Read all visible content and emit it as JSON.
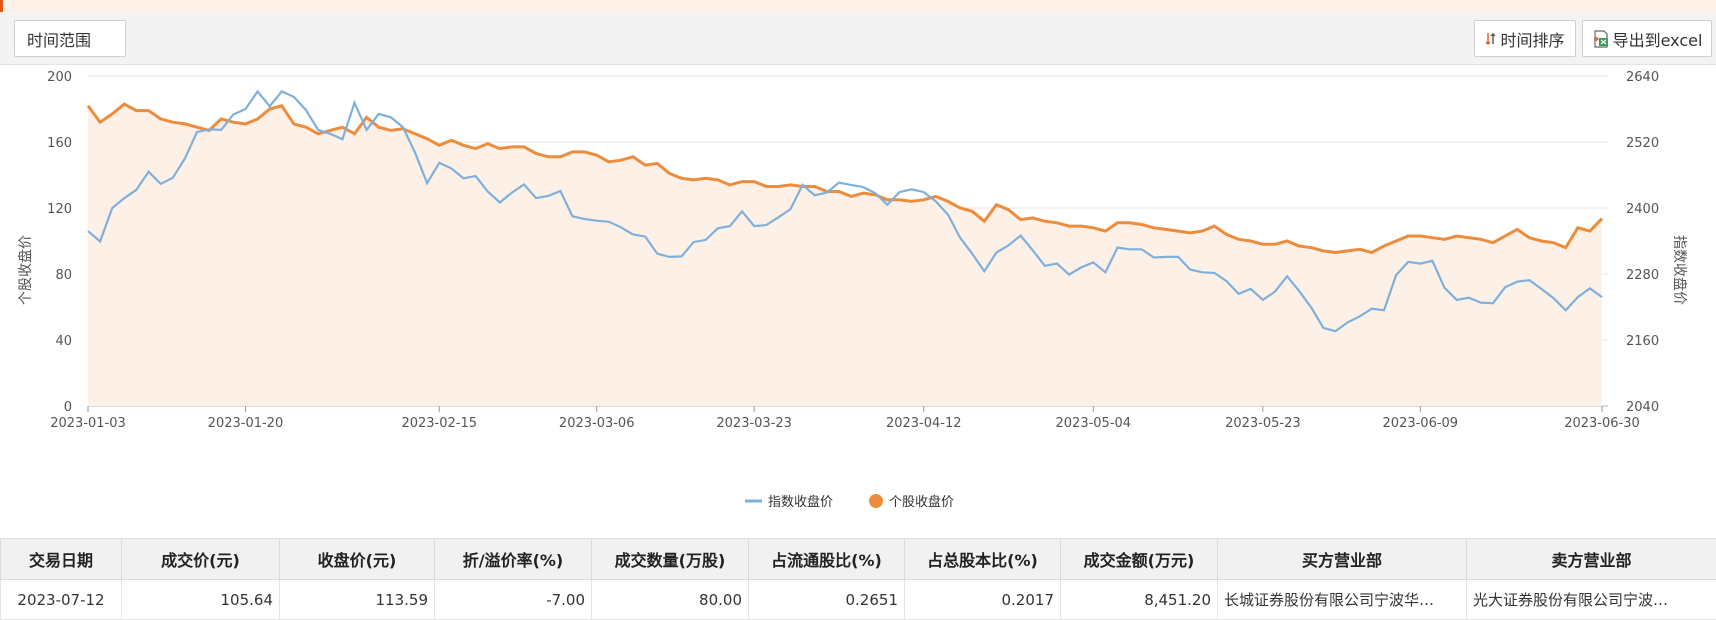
{
  "toolbar": {
    "range_label": "时间范围",
    "sort_label": "时间排序",
    "export_label": "导出到excel"
  },
  "colors": {
    "index_line": "#7fb0dc",
    "stock_line": "#ec8c3c",
    "stock_fill": "#fdf0e6"
  },
  "chart_data": {
    "type": "line",
    "xlabel": "",
    "ylabel_left": "个股收盘价",
    "ylabel_right": "指数收盘价",
    "left_ylim": [
      0,
      200
    ],
    "left_ticks": [
      "200",
      "160",
      "120",
      "80",
      "40",
      "0"
    ],
    "right_ylim": [
      2040,
      2640
    ],
    "right_ticks": [
      "2640",
      "2520",
      "2400",
      "2280",
      "2160",
      "2040"
    ],
    "x_ticks": [
      "2023-01-03",
      "2023-01-20",
      "2023-02-15",
      "2023-03-06",
      "2023-03-23",
      "2023-04-12",
      "2023-05-04",
      "2023-05-23",
      "2023-06-09",
      "2023-06-30"
    ],
    "grid": true,
    "legend_position": "bottom-center",
    "series": [
      {
        "name": "指数收盘价",
        "axis": "right",
        "values": [
          2358,
          2339,
          2400,
          2418,
          2433,
          2466,
          2444,
          2455,
          2490,
          2538,
          2543,
          2542,
          2570,
          2580,
          2612,
          2585,
          2612,
          2602,
          2578,
          2542,
          2535,
          2525,
          2591,
          2542,
          2571,
          2565,
          2547,
          2501,
          2445,
          2482,
          2472,
          2454,
          2458,
          2430,
          2410,
          2428,
          2443,
          2418,
          2422,
          2431,
          2385,
          2380,
          2377,
          2375,
          2365,
          2352,
          2348,
          2317,
          2311,
          2312,
          2338,
          2342,
          2363,
          2367,
          2394,
          2367,
          2369,
          2383,
          2398,
          2442,
          2423,
          2428,
          2446,
          2442,
          2438,
          2427,
          2406,
          2429,
          2434,
          2429,
          2412,
          2388,
          2346,
          2317,
          2285,
          2319,
          2332,
          2350,
          2323,
          2295,
          2299,
          2279,
          2292,
          2301,
          2283,
          2328,
          2325,
          2325,
          2310,
          2311,
          2311,
          2288,
          2283,
          2282,
          2267,
          2244,
          2253,
          2233,
          2248,
          2276,
          2249,
          2219,
          2182,
          2176,
          2192,
          2203,
          2217,
          2214,
          2278,
          2302,
          2299,
          2304,
          2255,
          2233,
          2237,
          2228,
          2227,
          2256,
          2266,
          2269,
          2253,
          2236,
          2214,
          2238,
          2254,
          2238
        ]
      },
      {
        "name": "个股收盘价",
        "axis": "left",
        "values": [
          182,
          172,
          177,
          183,
          179,
          179,
          174,
          172,
          171,
          169,
          167,
          174,
          172,
          171,
          174,
          180,
          182,
          171,
          169,
          165,
          167,
          169,
          165,
          175,
          169,
          167,
          168,
          165,
          162,
          158,
          161,
          158,
          156,
          159,
          156,
          157,
          157,
          153,
          151,
          151,
          154,
          154,
          152,
          148,
          149,
          151,
          146,
          147,
          141,
          138,
          137,
          138,
          137,
          134,
          136,
          136,
          133,
          133,
          134,
          133,
          133,
          130,
          130,
          127,
          129,
          128,
          125,
          125,
          124,
          125,
          127,
          124,
          120,
          118,
          112,
          122,
          119,
          113,
          114,
          112,
          111,
          109,
          109,
          108,
          106,
          111,
          111,
          110,
          108,
          107,
          106,
          105,
          106,
          109,
          104,
          101,
          100,
          98,
          98,
          100,
          97,
          96,
          94,
          93,
          94,
          95,
          93,
          97,
          100,
          103,
          103,
          102,
          101,
          103,
          102,
          101,
          99,
          103,
          107,
          102,
          100,
          99,
          96,
          108,
          106,
          113.59
        ]
      }
    ]
  },
  "table": {
    "headers": [
      "交易日期",
      "成交价(元)",
      "收盘价(元)",
      "折/溢价率(%)",
      "成交数量(万股)",
      "占流通股比(%)",
      "占总股本比(%)",
      "成交金额(万元)",
      "买方营业部",
      "卖方营业部"
    ],
    "rows": [
      [
        "2023-07-12",
        "105.64",
        "113.59",
        "-7.00",
        "80.00",
        "0.2651",
        "0.2017",
        "8,451.20",
        "长城证券股份有限公司宁波华…",
        "光大证券股份有限公司宁波…"
      ]
    ]
  }
}
